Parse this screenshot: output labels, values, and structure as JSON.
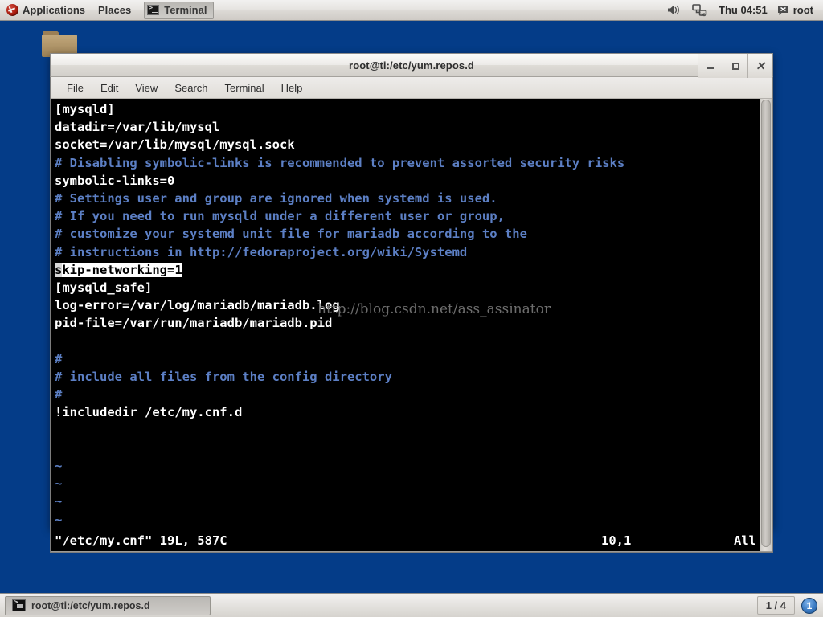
{
  "top_panel": {
    "applications_label": "Applications",
    "places_label": "Places",
    "window_entry_label": "Terminal",
    "clock": "Thu 04:51",
    "user_label": "root",
    "icons": {
      "distro": "fedora-logo-icon",
      "volume": "speaker-icon",
      "network": "network-disconnected-icon",
      "terminal": "terminal-icon",
      "user": "chat-status-icon"
    }
  },
  "desktop": {
    "folder_icon_name": "folder-icon"
  },
  "window": {
    "title": "root@ti:/etc/yum.repos.d",
    "buttons": {
      "minimize": "_",
      "maximize": "□",
      "close": "✕"
    },
    "menus": [
      "File",
      "Edit",
      "View",
      "Search",
      "Terminal",
      "Help"
    ]
  },
  "terminal": {
    "lines": [
      {
        "text": "[mysqld]",
        "type": "code"
      },
      {
        "text": "datadir=/var/lib/mysql",
        "type": "code"
      },
      {
        "text": "socket=/var/lib/mysql/mysql.sock",
        "type": "code"
      },
      {
        "text": "# Disabling symbolic-links is recommended to prevent assorted security risks",
        "type": "comment"
      },
      {
        "text": "symbolic-links=0",
        "type": "code"
      },
      {
        "text": "# Settings user and group are ignored when systemd is used.",
        "type": "comment"
      },
      {
        "text": "# If you need to run mysqld under a different user or group,",
        "type": "comment"
      },
      {
        "text": "# customize your systemd unit file for mariadb according to the",
        "type": "comment"
      },
      {
        "text": "# instructions in http://fedoraproject.org/wiki/Systemd",
        "type": "comment"
      },
      {
        "text": "skip-networking=1",
        "type": "highlight"
      },
      {
        "text": "[mysqld_safe]",
        "type": "code"
      },
      {
        "text": "log-error=/var/log/mariadb/mariadb.log",
        "type": "code"
      },
      {
        "text": "pid-file=/var/run/mariadb/mariadb.pid",
        "type": "code"
      },
      {
        "text": "",
        "type": "code"
      },
      {
        "text": "#",
        "type": "comment"
      },
      {
        "text": "# include all files from the config directory",
        "type": "comment"
      },
      {
        "text": "#",
        "type": "comment"
      },
      {
        "text": "!includedir /etc/my.cnf.d",
        "type": "code"
      },
      {
        "text": "",
        "type": "code"
      },
      {
        "text": "",
        "type": "code"
      },
      {
        "text": "~",
        "type": "tilde"
      },
      {
        "text": "~",
        "type": "tilde"
      },
      {
        "text": "~",
        "type": "tilde"
      },
      {
        "text": "~",
        "type": "tilde"
      }
    ],
    "status": {
      "file_info": "\"/etc/my.cnf\" 19L, 587C",
      "position": "10,1",
      "scroll": "All"
    },
    "watermark": "http://blog.csdn.net/ass_assinator",
    "colors": {
      "background": "#000000",
      "foreground": "#ffffff",
      "comment": "#5c7fc4",
      "highlight_bg": "#ffffff",
      "highlight_fg": "#000000"
    }
  },
  "bottom_panel": {
    "task_label": "root@ti:/etc/yum.repos.d",
    "workspace": "1 / 4",
    "notification_count": "1"
  },
  "theme": {
    "desktop_background": "#043c88",
    "panel_background": "#e4e2df",
    "accent": "#3c7cc4"
  }
}
